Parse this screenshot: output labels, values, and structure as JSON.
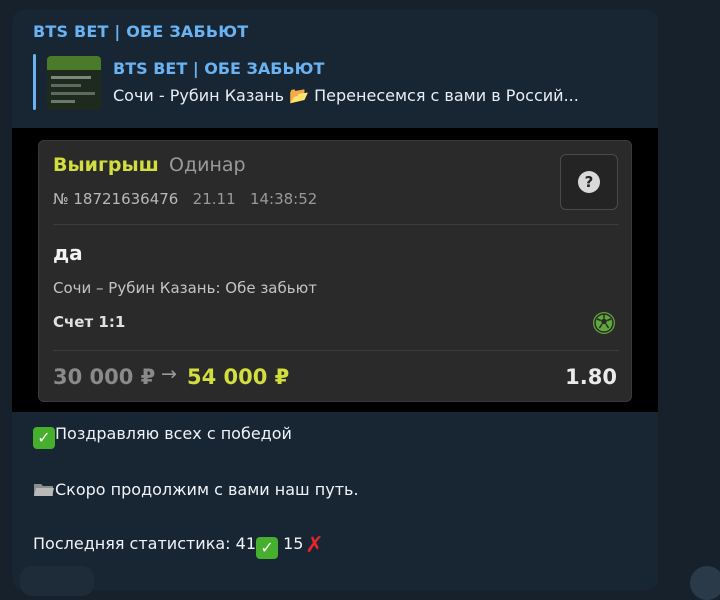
{
  "message": {
    "channel_name": "BTS BET | ОБЕ ЗАБЬЮТ",
    "reply": {
      "title": "BTS BET | ОБЕ ЗАБЬЮТ",
      "text": "Сочи - Рубин Казань 📂 Перенесемся с вами в Россий..."
    },
    "bet_slip": {
      "status": "Выигрыш",
      "type": "Одинар",
      "number": "№ 18721636476",
      "date": "21.11",
      "time": "14:38:52",
      "help_icon": "?",
      "pick": "да",
      "event": "Сочи – Рубин Казань: Обе забьют",
      "score": "Счет 1:1",
      "stake": "30 000 ₽",
      "arrow": "→",
      "payout": "54 000 ₽",
      "odds": "1.80",
      "accent_color": "#d2de3f"
    },
    "lines": {
      "congrats": "Поздравляю всех с победой",
      "continue": "Скоро продолжим с вами наш путь.",
      "stats_prefix": "Последняя статистика: 41",
      "stats_losses": "15"
    },
    "emoji": {
      "check": "✓",
      "cross": "✗"
    },
    "icons": [
      "folder-icon",
      "check-mark-icon",
      "cross-mark-icon",
      "help-icon",
      "soccer-ball-icon"
    ]
  }
}
